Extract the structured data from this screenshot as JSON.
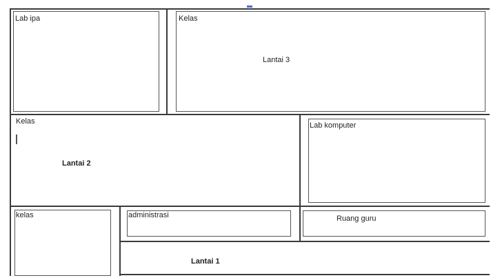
{
  "floor3": {
    "room_left": "Lab ipa",
    "room_right": "Kelas",
    "floor_label": "Lantai 3"
  },
  "floor2": {
    "room_left": "Kelas",
    "room_right": "Lab komputer",
    "floor_label": "Lantai 2"
  },
  "floor1": {
    "room_left": "kelas",
    "room_mid": "administrasi",
    "room_right": "Ruang guru",
    "floor_label": "Lantai 1"
  },
  "colors": {
    "line": "#3a3a3a",
    "accent": "#4a6fd0"
  }
}
